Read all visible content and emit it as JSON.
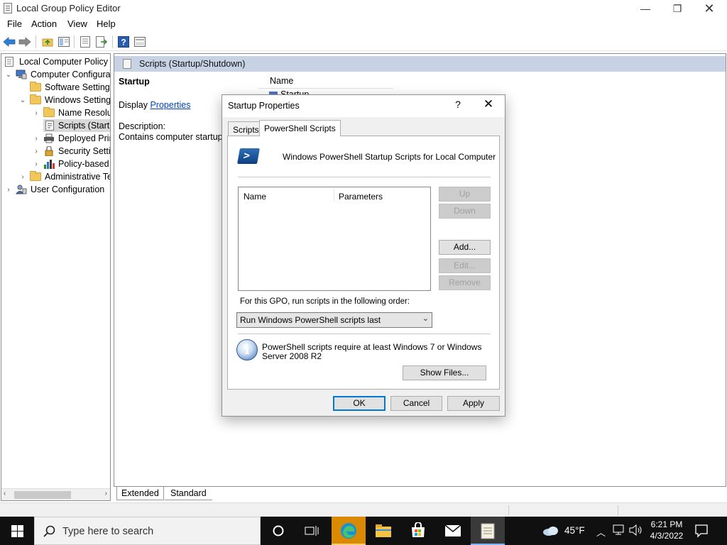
{
  "window": {
    "title": "Local Group Policy Editor",
    "minimize": "—",
    "maximize": "❐",
    "close": "✕"
  },
  "menu": [
    "File",
    "Action",
    "View",
    "Help"
  ],
  "toolbar": {
    "icons": [
      "back-arrow-icon",
      "forward-arrow-icon",
      "up-folder-icon",
      "show-hide-tree-icon",
      "properties-icon",
      "export-list-icon",
      "help-icon",
      "show-console-icon"
    ]
  },
  "tree": {
    "items": [
      {
        "label": "Local Computer Policy",
        "indent": 0,
        "twisty": "",
        "icon": "policy-icon"
      },
      {
        "label": "Computer Configuration",
        "indent": 1,
        "twisty": "⌄",
        "icon": "computer-icon"
      },
      {
        "label": "Software Settings",
        "indent": 2,
        "twisty": "",
        "icon": "folder-icon"
      },
      {
        "label": "Windows Settings",
        "indent": 2,
        "twisty": "⌄",
        "icon": "folder-icon"
      },
      {
        "label": "Name Resolution Policy",
        "indent": 3,
        "twisty": "›",
        "icon": "folder-icon"
      },
      {
        "label": "Scripts (Startup/Shutdown)",
        "indent": 3,
        "twisty": "",
        "icon": "script-icon"
      },
      {
        "label": "Deployed Printers",
        "indent": 3,
        "twisty": "›",
        "icon": "printer-icon"
      },
      {
        "label": "Security Settings",
        "indent": 3,
        "twisty": "›",
        "icon": "security-icon"
      },
      {
        "label": "Policy-based QoS",
        "indent": 3,
        "twisty": "›",
        "icon": "chart-icon"
      },
      {
        "label": "Administrative Templates",
        "indent": 2,
        "twisty": "›",
        "icon": "folder-icon"
      },
      {
        "label": "User Configuration",
        "indent": 1,
        "twisty": "›",
        "icon": "user-icon"
      }
    ]
  },
  "right_pane": {
    "header": "Scripts (Startup/Shutdown)",
    "section_title": "Startup",
    "display_label": "Display ",
    "properties_link": "Properties",
    "description_label": "Description:",
    "description_text": "Contains computer startup scripts.",
    "column_name": "Name",
    "item": "Startup"
  },
  "bottom_tabs": {
    "extended": "Extended",
    "standard": "Standard"
  },
  "dialog": {
    "title": "Startup Properties",
    "help": "?",
    "close": "✕",
    "tabs": {
      "scripts": "Scripts",
      "powershell": "PowerShell Scripts"
    },
    "heading": "Windows PowerShell Startup Scripts for Local Computer",
    "list_columns": {
      "name": "Name",
      "parameters": "Parameters"
    },
    "buttons": {
      "up": "Up",
      "down": "Down",
      "add": "Add...",
      "edit": "Edit...",
      "remove": "Remove",
      "show_files": "Show Files...",
      "ok": "OK",
      "cancel": "Cancel",
      "apply": "Apply"
    },
    "order_label": "For this GPO, run scripts in the following order:",
    "order_value": "Run Windows PowerShell scripts last",
    "info_text": "PowerShell scripts require at least Windows 7 or Windows Server 2008 R2"
  },
  "taskbar": {
    "search_placeholder": "Type here to search",
    "weather": "45°F",
    "time": "6:21 PM",
    "date": "4/3/2022",
    "colors": {
      "bg": "#101010",
      "active_app": "#d98a00"
    }
  }
}
